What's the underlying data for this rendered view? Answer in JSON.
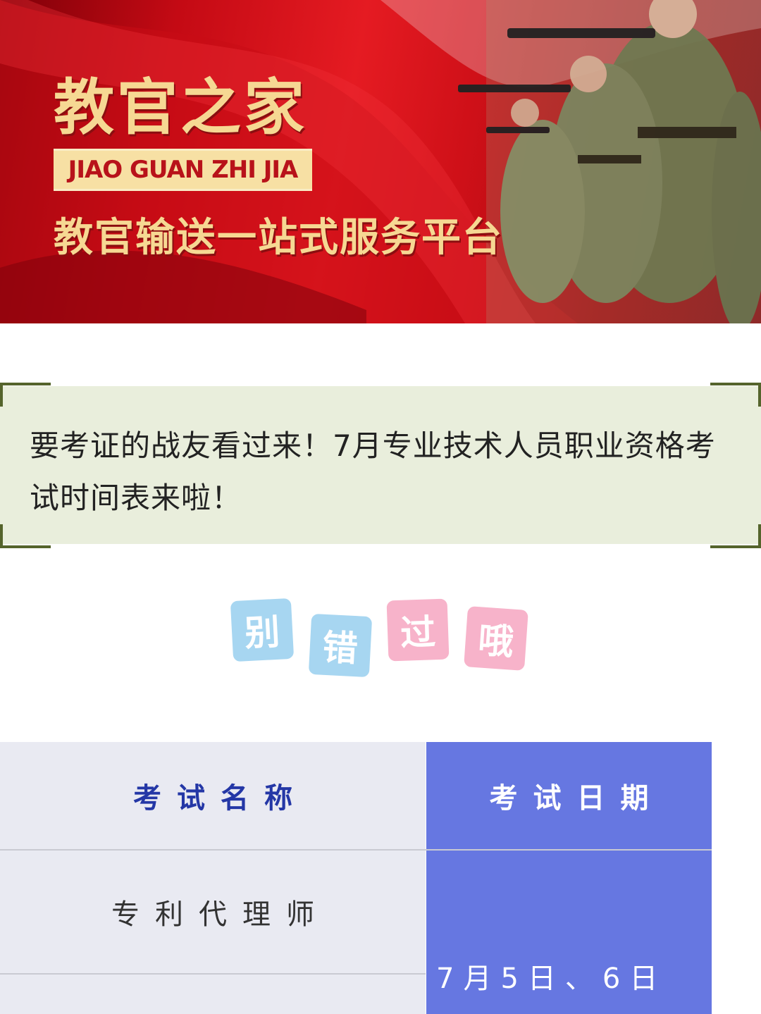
{
  "banner": {
    "title": "教官之家",
    "subtitle": "JIAO GUAN ZHI JIA",
    "slogan": "教官输送一站式服务平台"
  },
  "headline": {
    "text": "要考证的战友看过来！7月专业技术人员职业资格考试时间表来啦！"
  },
  "tiles": [
    "别",
    "错",
    "过",
    "哦"
  ],
  "colors": {
    "banner_red": "#e51b22",
    "gold_text": "#f6d893",
    "headline_bg": "#e9eedc",
    "corner_green": "#55642c",
    "tile_blue": "#a7d6f1",
    "tile_pink": "#f7b3ca",
    "table_left_bg": "#e9eaf2",
    "table_right_bg": "#6677e1",
    "header_blue_text": "#2437a6"
  },
  "table": {
    "headers": [
      "考试名称",
      "考试日期"
    ],
    "rows": [
      {
        "name": "专利代理师",
        "date": "7月5日、6日"
      }
    ]
  }
}
